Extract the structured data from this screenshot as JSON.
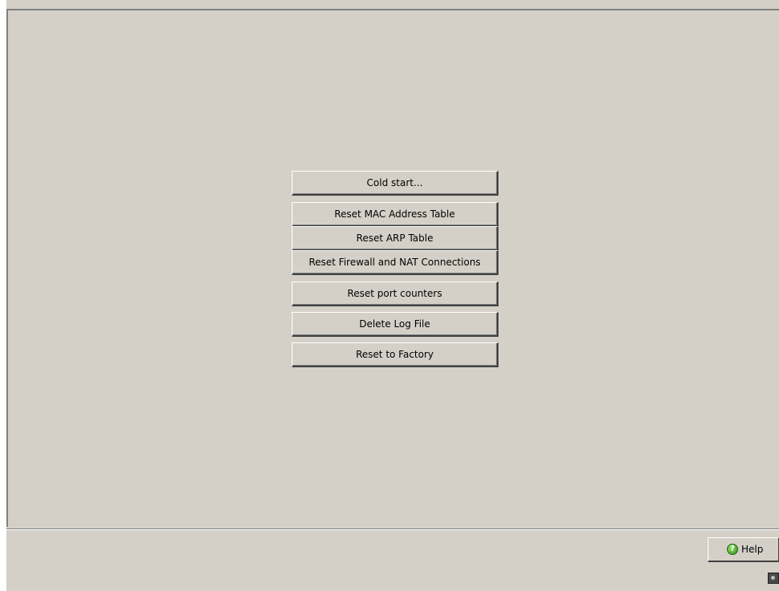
{
  "actions": {
    "buttons": [
      {
        "id": "cold-start",
        "label": "Cold start..."
      },
      {
        "id": "reset-mac",
        "label": "Reset MAC Address Table"
      },
      {
        "id": "reset-arp",
        "label": "Reset ARP Table"
      },
      {
        "id": "reset-firewall-nat",
        "label": "Reset Firewall and NAT Connections"
      },
      {
        "id": "reset-port-counters",
        "label": "Reset port counters"
      },
      {
        "id": "delete-log",
        "label": "Delete Log File"
      },
      {
        "id": "reset-factory",
        "label": "Reset to Factory"
      }
    ]
  },
  "footer": {
    "help_label": "Help",
    "help_icon": "help-icon",
    "status_icon": "status-indicator-icon"
  },
  "colors": {
    "background": "#d4d0c8",
    "help_icon_green": "#2f8a1a"
  }
}
